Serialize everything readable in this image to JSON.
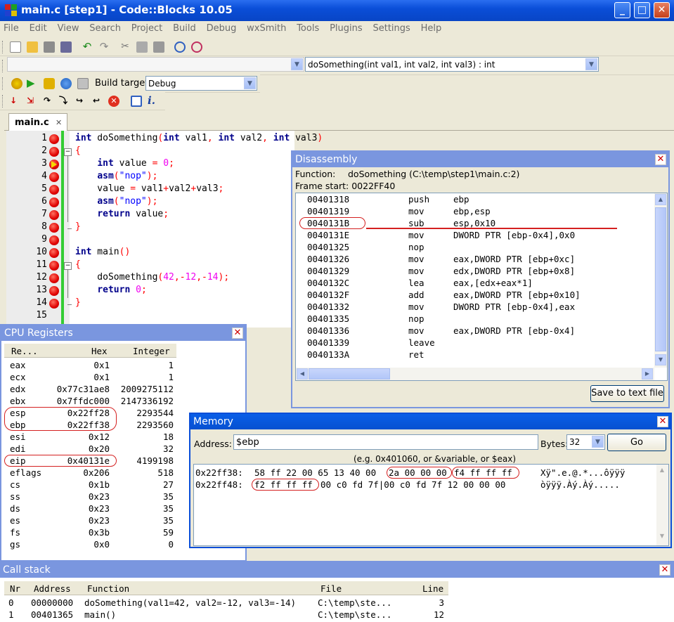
{
  "window": {
    "title": "main.c [step1] - Code::Blocks 10.05",
    "min": "_",
    "max": "□",
    "close": "✕"
  },
  "menu": [
    "File",
    "Edit",
    "View",
    "Search",
    "Project",
    "Build",
    "Debug",
    "wxSmith",
    "Tools",
    "Plugins",
    "Settings",
    "Help"
  ],
  "toolbar": {
    "function_combo": "doSomething(int val1, int val2, int val3) : int",
    "build_target_label": "Build target:",
    "build_target_value": "Debug"
  },
  "editor": {
    "tab": "main.c",
    "tab_close": "✕",
    "lines": [
      {
        "n": "1",
        "html": "<span class='kw'>int</span> doSomething<span class='op'>(</span><span class='kw'>int</span> val1<span class='op'>,</span> <span class='kw'>int</span> val2<span class='op'>,</span> <span class='kw'>int</span> val3<span class='op'>)</span>"
      },
      {
        "n": "2",
        "html": "<span class='op'>{</span>"
      },
      {
        "n": "3",
        "html": "    <span class='kw'>int</span> value <span class='op'>=</span> <span class='num'>0</span><span class='op'>;</span>"
      },
      {
        "n": "4",
        "html": "    <span class='kw'>asm</span><span class='op'>(</span><span class='str'>\"nop\"</span><span class='op'>);</span>"
      },
      {
        "n": "5",
        "html": "    value <span class='op'>=</span> val1<span class='op'>+</span>val2<span class='op'>+</span>val3<span class='op'>;</span>"
      },
      {
        "n": "6",
        "html": "    <span class='kw'>asm</span><span class='op'>(</span><span class='str'>\"nop\"</span><span class='op'>);</span>"
      },
      {
        "n": "7",
        "html": "    <span class='kw'>return</span> value<span class='op'>;</span>"
      },
      {
        "n": "8",
        "html": "<span class='op'>}</span>"
      },
      {
        "n": "9",
        "html": ""
      },
      {
        "n": "10",
        "html": "<span class='kw'>int</span> main<span class='op'>()</span>"
      },
      {
        "n": "11",
        "html": "<span class='op'>{</span>"
      },
      {
        "n": "12",
        "html": "    doSomething<span class='op'>(</span><span class='num'>42</span><span class='op'>,-</span><span class='num'>12</span><span class='op'>,-</span><span class='num'>14</span><span class='op'>);</span>"
      },
      {
        "n": "13",
        "html": "    <span class='kw'>return</span> <span class='num'>0</span><span class='op'>;</span>"
      },
      {
        "n": "14",
        "html": "<span class='op'>}</span>"
      },
      {
        "n": "15",
        "html": ""
      }
    ]
  },
  "disassembly": {
    "title": "Disassembly",
    "function_label": "Function:",
    "function_value": "doSomething (C:\\temp\\step1\\main.c:2)",
    "frame_label": "Frame start: 0022FF40",
    "rows": [
      [
        "00401318",
        "push",
        "ebp"
      ],
      [
        "00401319",
        "mov",
        "ebp,esp"
      ],
      [
        "0040131B",
        "sub",
        "esp,0x10"
      ],
      [
        "0040131E",
        "mov",
        "DWORD PTR [ebp-0x4],0x0"
      ],
      [
        "00401325",
        "nop",
        ""
      ],
      [
        "00401326",
        "mov",
        "eax,DWORD PTR [ebp+0xc]"
      ],
      [
        "00401329",
        "mov",
        "edx,DWORD PTR [ebp+0x8]"
      ],
      [
        "0040132C",
        "lea",
        "eax,[edx+eax*1]"
      ],
      [
        "0040132F",
        "add",
        "eax,DWORD PTR [ebp+0x10]"
      ],
      [
        "00401332",
        "mov",
        "DWORD PTR [ebp-0x4],eax"
      ],
      [
        "00401335",
        "nop",
        ""
      ],
      [
        "00401336",
        "mov",
        "eax,DWORD PTR [ebp-0x4]"
      ],
      [
        "00401339",
        "leave",
        ""
      ],
      [
        "0040133A",
        "ret",
        ""
      ]
    ],
    "save_button": "Save to text file"
  },
  "registers": {
    "title": "CPU Registers",
    "headers": [
      "Re...",
      "Hex",
      "Integer"
    ],
    "rows": [
      [
        "eax",
        "0x1",
        "1"
      ],
      [
        "ecx",
        "0x1",
        "1"
      ],
      [
        "edx",
        "0x77c31ae8",
        "2009275112"
      ],
      [
        "ebx",
        "0x7ffdc000",
        "2147336192"
      ],
      [
        "esp",
        "0x22ff28",
        "2293544"
      ],
      [
        "ebp",
        "0x22ff38",
        "2293560"
      ],
      [
        "esi",
        "0x12",
        "18"
      ],
      [
        "edi",
        "0x20",
        "32"
      ],
      [
        "eip",
        "0x40131e",
        "4199198"
      ],
      [
        "eflags",
        "0x206",
        "518"
      ],
      [
        "cs",
        "0x1b",
        "27"
      ],
      [
        "ss",
        "0x23",
        "35"
      ],
      [
        "ds",
        "0x23",
        "35"
      ],
      [
        "es",
        "0x23",
        "35"
      ],
      [
        "fs",
        "0x3b",
        "59"
      ],
      [
        "gs",
        "0x0",
        "0"
      ]
    ]
  },
  "memory": {
    "title": "Memory",
    "address_label": "Address:",
    "address_value": "$ebp",
    "bytes_label": "Bytes:",
    "bytes_value": "32",
    "go_button": "Go",
    "hint": "(e.g. 0x401060, or &variable, or $eax)",
    "line1": {
      "addr": "0x22ff38:",
      "a": "58 ff 22 00 65 13 40 00",
      "b": "2a 00 00 00",
      "c": "f4 ff ff ff",
      "ascii": "Xÿ\".e.@.*...ôÿÿÿ"
    },
    "line2": {
      "addr": "0x22ff48:",
      "a": "f2 ff ff ff",
      "b": "00 c0 fd 7f|00 c0 fd 7f 12 00 00 00",
      "ascii": "òÿÿÿ.Àý.Àý....."
    }
  },
  "callstack": {
    "title": "Call stack",
    "headers": [
      "Nr",
      "Address",
      "Function",
      "File",
      "Line"
    ],
    "rows": [
      [
        "0",
        "00000000",
        "doSomething(val1=42, val2=-12, val3=-14)",
        "C:\\temp\\ste...",
        "3"
      ],
      [
        "1",
        "00401365",
        "main()",
        "C:\\temp\\ste...",
        "12"
      ]
    ]
  }
}
